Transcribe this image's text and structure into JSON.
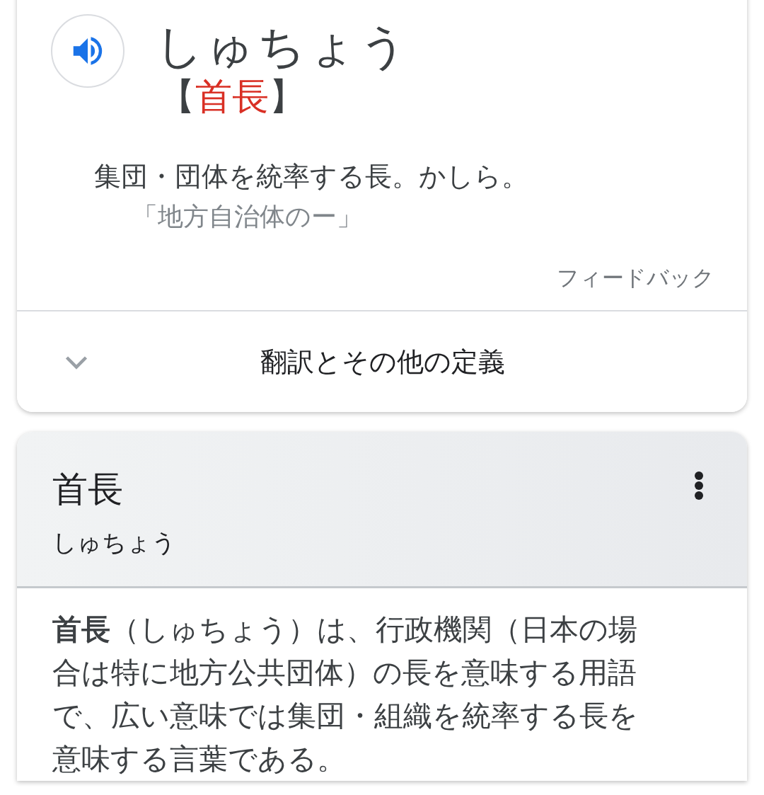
{
  "dictionary_card": {
    "reading": "しゅちょう",
    "bracket_open": "【",
    "headword": "首長",
    "bracket_close": "】",
    "definition": "集団・団体を統率する長。かしら。",
    "example": "「地方自治体のー」",
    "feedback": "フィードバック",
    "more": {
      "label": "翻訳とその他の定義",
      "expanded": false
    }
  },
  "knowledge_card": {
    "title": "首長",
    "subtitle": "しゅちょう",
    "description": "**首長**（しゅちょう）は、行政機関（日本の場合は特に地方公共団体）の長を意味する用語で、広い意味では集団・組織を統率する長を意味する言葉である。"
  }
}
